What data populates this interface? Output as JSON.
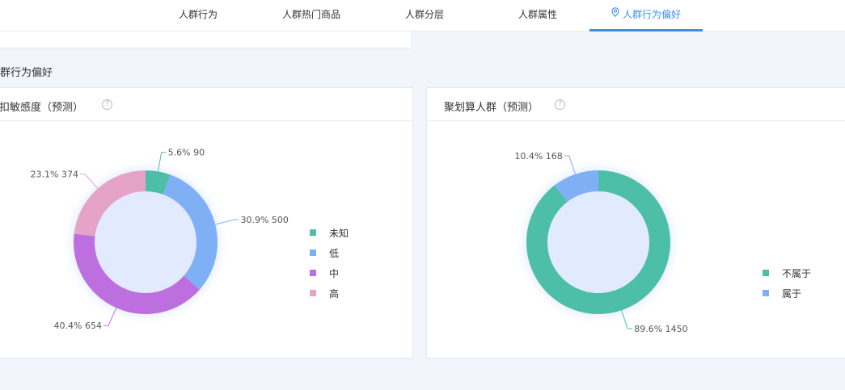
{
  "nav": {
    "tabs": [
      {
        "label": "人群行为",
        "active": false
      },
      {
        "label": "人群热门商品",
        "active": false
      },
      {
        "label": "人群分层",
        "active": false
      },
      {
        "label": "人群属性",
        "active": false
      },
      {
        "label": "人群行为偏好",
        "active": true,
        "icon": "location-pin-icon"
      }
    ],
    "accent_color": "#3f8fe6"
  },
  "section": {
    "title": "群行为偏好"
  },
  "left_card": {
    "title": "扣敏感度（预测）",
    "help": "?"
  },
  "right_card": {
    "title": "聚划算人群（预测）",
    "help": "?"
  },
  "chart_data": [
    {
      "type": "pie",
      "donut": true,
      "title": "扣敏感度（预测）",
      "legend_position": "right",
      "slices": [
        {
          "name": "未知",
          "value": 90,
          "percent": 5.6,
          "label": "5.6% 90",
          "color": "#4dbfa8"
        },
        {
          "name": "低",
          "value": 500,
          "percent": 30.9,
          "label": "30.9% 500",
          "color": "#7fb0f5"
        },
        {
          "name": "中",
          "value": 654,
          "percent": 40.4,
          "label": "40.4% 654",
          "color": "#bd6fe0"
        },
        {
          "name": "高",
          "value": 374,
          "percent": 23.1,
          "label": "23.1% 374",
          "color": "#e6a3c8"
        }
      ]
    },
    {
      "type": "pie",
      "donut": true,
      "title": "聚划算人群（预测）",
      "legend_position": "bottom-right",
      "slices": [
        {
          "name": "不属于",
          "value": 1450,
          "percent": 89.6,
          "label": "89.6% 1450",
          "color": "#4dbfa8"
        },
        {
          "name": "属于",
          "value": 168,
          "percent": 10.4,
          "label": "10.4% 168",
          "color": "#7fb0f5"
        }
      ]
    }
  ]
}
